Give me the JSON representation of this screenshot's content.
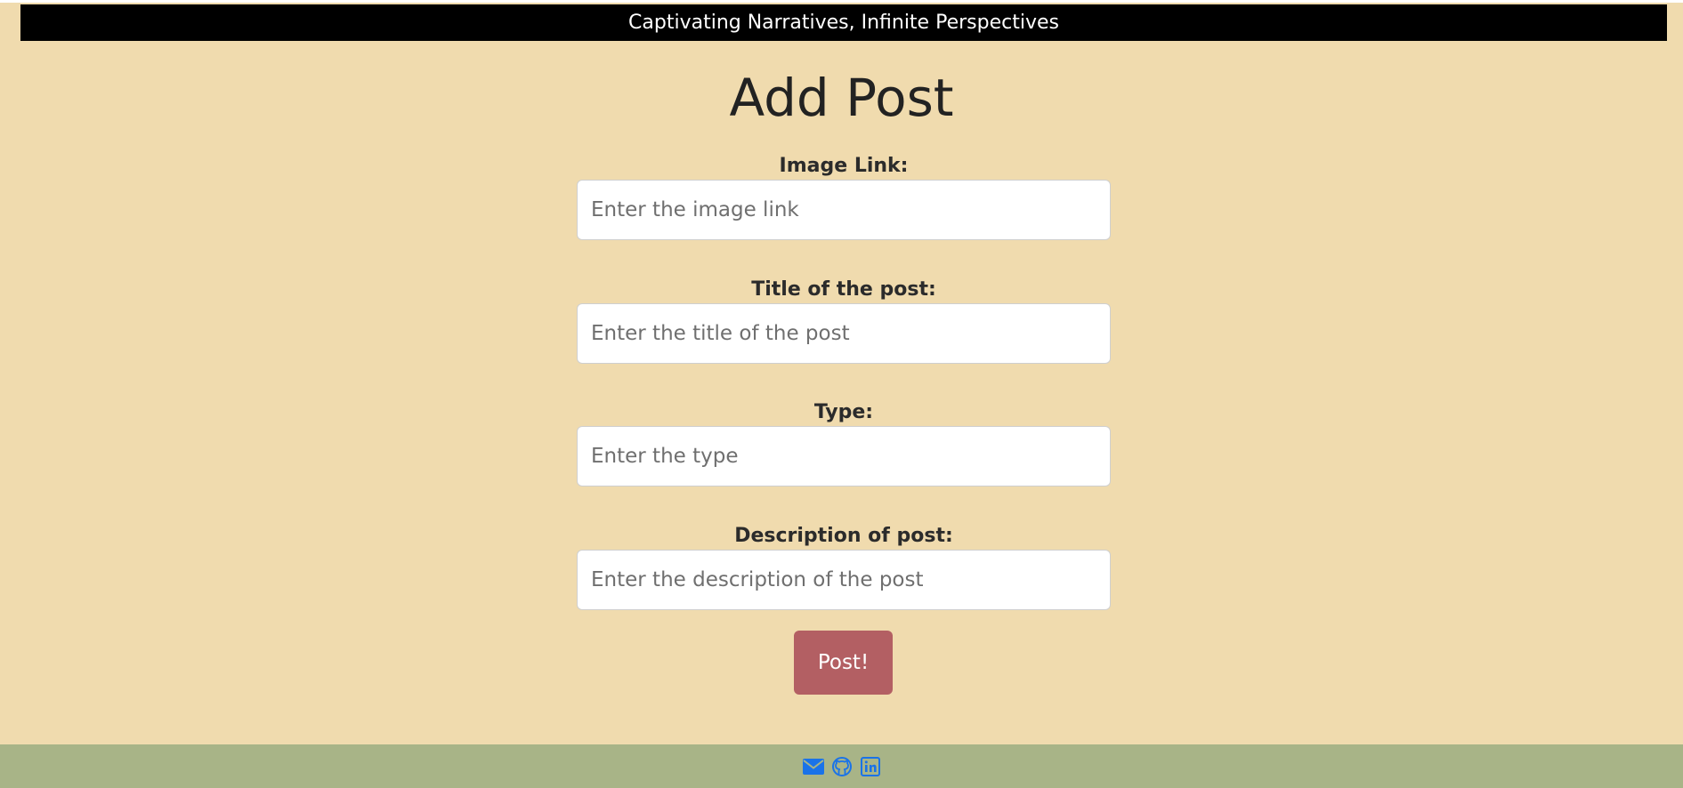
{
  "header": {
    "tagline": "Captivating Narratives, Infinite Perspectives"
  },
  "main": {
    "title": "Add Post",
    "form": {
      "fields": [
        {
          "label": "Image Link:",
          "placeholder": "Enter the image link",
          "value": ""
        },
        {
          "label": "Title of the post:",
          "placeholder": "Enter the title of the post",
          "value": ""
        },
        {
          "label": "Type:",
          "placeholder": "Enter the type",
          "value": ""
        },
        {
          "label": "Description of post:",
          "placeholder": "Enter the description of the post",
          "value": ""
        }
      ],
      "submit_label": "Post!"
    }
  },
  "footer": {
    "icons": [
      "envelope-icon",
      "github-icon",
      "linkedin-icon"
    ]
  },
  "colors": {
    "page_background": "#f0dbae",
    "banner_background": "#000000",
    "button_background": "#b35f63",
    "footer_background": "#a8b487",
    "icon_color": "#1a73e8"
  }
}
